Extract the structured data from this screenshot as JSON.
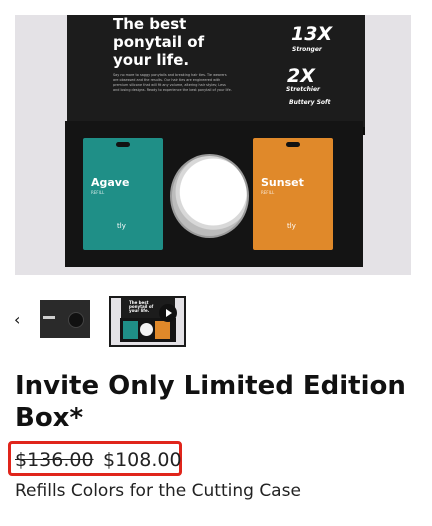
{
  "hero": {
    "headline": "The best ponytail of your life.",
    "fineprint": "Say no more to saggy ponytails and breaking hair ties. Tie wearers are obsessed and the results. Our hair ties are engineered with premium silicone that will fit any volume, altering hair styles; Less and losing designs. Ready to experience the best ponytail of your life.",
    "stats": [
      {
        "value": "13X",
        "label": "Stronger"
      },
      {
        "value": "2X",
        "label": "Stretchier"
      },
      {
        "value": "",
        "label": "Buttery Soft"
      }
    ],
    "pouches": [
      {
        "name": "Agave",
        "sub": "REFILL",
        "brand": "tly",
        "color": "#1f8f87"
      },
      {
        "name": "Sunset",
        "sub": "REFILL",
        "brand": "tly",
        "color": "#e0892a"
      }
    ]
  },
  "gallery": {
    "prev_icon": "chevron-left-icon",
    "prev_glyph": "‹",
    "thumb2_text": "The best ponytail of your life.",
    "thumb2_stat": "13X"
  },
  "product": {
    "title": "Invite Only Limited Edition Box*",
    "price_old": "$136.00",
    "price_new": "$108.00",
    "subtitle": "Refills Colors for the Cutting Case",
    "highlight_color": "#e0251b"
  }
}
